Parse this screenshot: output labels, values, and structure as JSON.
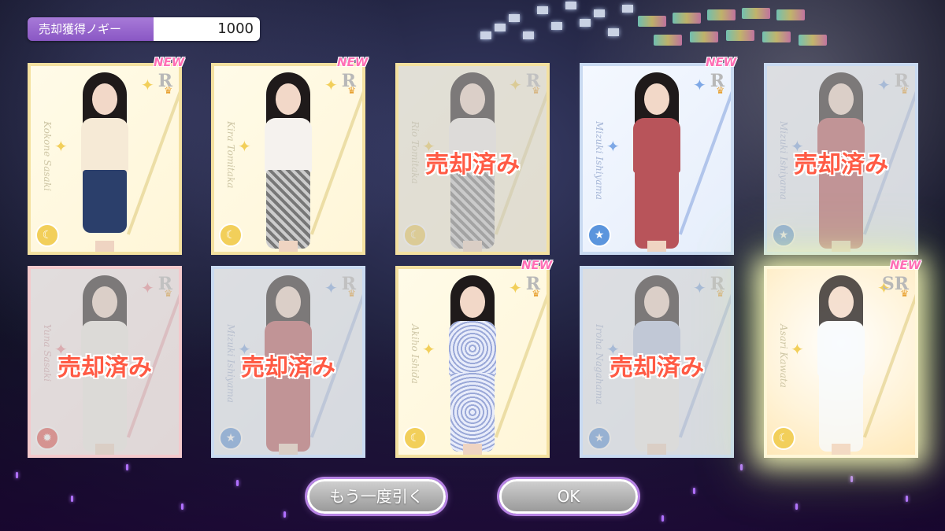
{
  "header": {
    "gain_label": "売却獲得ノギー",
    "gain_value": "1000"
  },
  "cards": [
    {
      "name": "Kokone Sasaki",
      "rarity": "R",
      "sold": false,
      "new": true,
      "theme": "yellow",
      "outfit": "cream",
      "type_icon": "moon-icon"
    },
    {
      "name": "Kira Tomitaka",
      "rarity": "R",
      "sold": false,
      "new": true,
      "theme": "yellow",
      "outfit": "gingham",
      "type_icon": "moon-icon"
    },
    {
      "name": "Rio Tomitaka",
      "rarity": "R",
      "sold": true,
      "new": false,
      "theme": "yellow",
      "outfit": "gingham",
      "type_icon": "moon-icon"
    },
    {
      "name": "Mizuki Ishiyama",
      "rarity": "R",
      "sold": false,
      "new": true,
      "theme": "blue",
      "outfit": "rose",
      "type_icon": "star-icon"
    },
    {
      "name": "Mizuki Ishiyama",
      "rarity": "R",
      "sold": true,
      "new": false,
      "theme": "blue",
      "outfit": "rose",
      "type_icon": "star-icon"
    },
    {
      "name": "Yuna Sasaki",
      "rarity": "R",
      "sold": true,
      "new": false,
      "theme": "red",
      "outfit": "white",
      "type_icon": "sun-icon"
    },
    {
      "name": "Mizuki Ishiyama",
      "rarity": "R",
      "sold": true,
      "new": false,
      "theme": "blue",
      "outfit": "rose",
      "type_icon": "star-icon"
    },
    {
      "name": "Akiho Ishida",
      "rarity": "R",
      "sold": false,
      "new": true,
      "theme": "yellow",
      "outfit": "floral",
      "type_icon": "moon-icon"
    },
    {
      "name": "Iroha Nagahama",
      "rarity": "R",
      "sold": true,
      "new": false,
      "theme": "blue",
      "outfit": "pastel",
      "type_icon": "star-icon"
    },
    {
      "name": "Asari Kawata",
      "rarity": "SR",
      "sold": false,
      "new": true,
      "theme": "yellow",
      "outfit": "glow",
      "type_icon": "moon-icon",
      "special": true
    }
  ],
  "labels": {
    "sold": "売却済み",
    "new": "NEW"
  },
  "buttons": {
    "redraw": "もう一度引く",
    "ok": "OK"
  },
  "colors": {
    "accent_purple": "#b784e4",
    "sold_red": "#ff5a44",
    "new_pink": "#ff6fb5"
  }
}
